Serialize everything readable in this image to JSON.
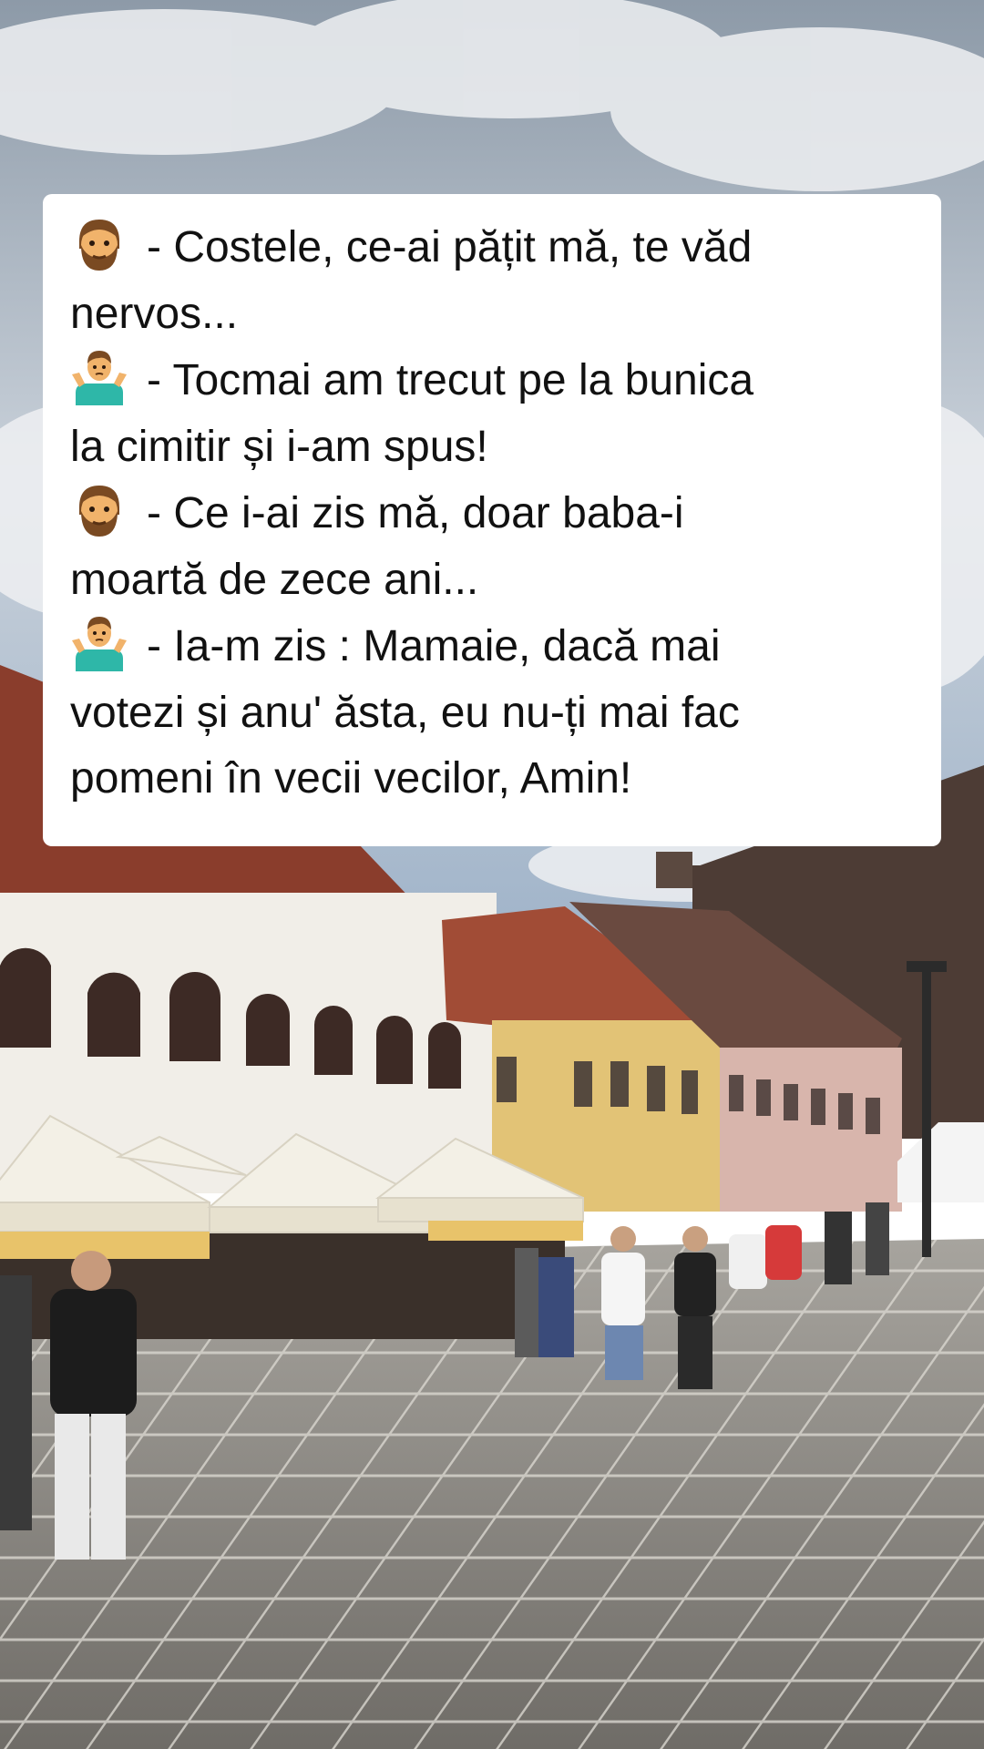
{
  "dialogue": [
    {
      "speaker_icon": "bearded-man-face-icon",
      "text": "- Costele, ce-ai pățit mă, te văd"
    },
    {
      "speaker_icon": "",
      "text": "nervos..."
    },
    {
      "speaker_icon": "man-shrugging-icon",
      "text": "- Tocmai am trecut pe la bunica"
    },
    {
      "speaker_icon": "",
      "text": "la cimitir și i-am spus!"
    },
    {
      "speaker_icon": "bearded-man-face-icon",
      "text": "- Ce i-ai zis mă, doar baba-i"
    },
    {
      "speaker_icon": "",
      "text": "moartă de zece ani..."
    },
    {
      "speaker_icon": "man-shrugging-icon",
      "text": "- Ia-m zis : Mamaie, dacă mai"
    },
    {
      "speaker_icon": "",
      "text": "votezi și anu' ăsta, eu nu-ți mai fac"
    },
    {
      "speaker_icon": "",
      "text": "pomeni în vecii vecilor, Amin!"
    }
  ],
  "colors": {
    "card_background": "#ffffff",
    "text": "#111111",
    "sky": "#b8c3cf",
    "roof": "#7a3b2a",
    "pavement": "#8b8a86",
    "umbrella": "#f3f0e6"
  }
}
